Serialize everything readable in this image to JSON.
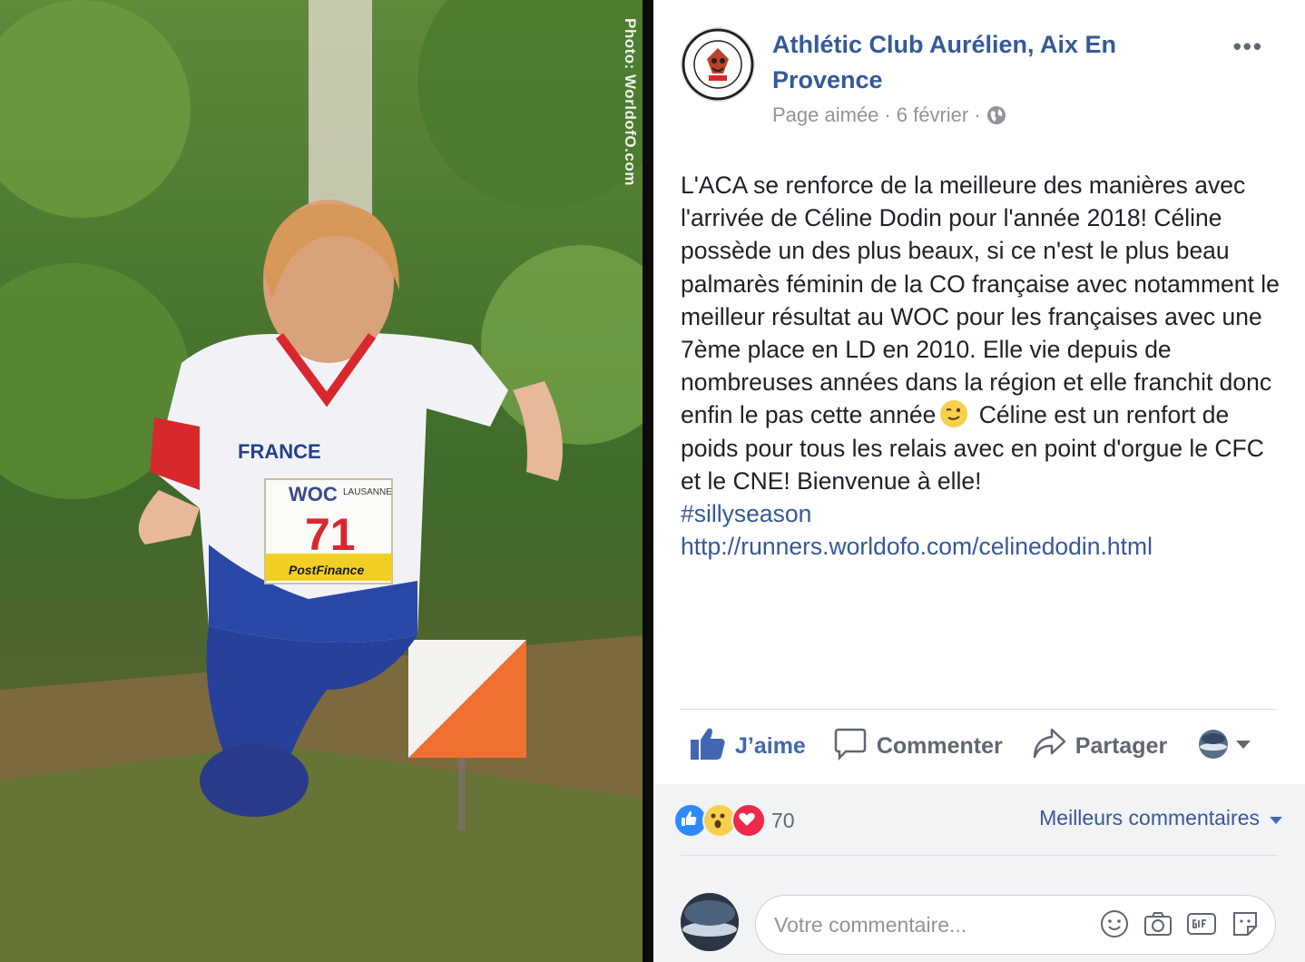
{
  "photo": {
    "credit": "Photo: WorldofO.com",
    "bib_number": "71",
    "bib_event": "WOC",
    "bib_event_detail": "LAUSANNE",
    "bib_sponsor": "PostFinance",
    "shirt_text": "FRANCE"
  },
  "post": {
    "page_name": "Athlétic Club Aurélien, Aix En Provence",
    "meta_status": "Page aimée",
    "meta_sep1": "·",
    "meta_date": "6 février",
    "meta_sep2": "·",
    "text_part1": "L'ACA se renforce de la meilleure des manières avec l'arrivée de Céline Dodin pour l'année 2018! Céline possède un des plus beaux, si ce n'est le plus beau palmarès féminin de la CO française avec notamment le meilleur résultat au WOC pour les françaises avec une 7ème place en LD en 2010. Elle vie depuis de nombreuses années dans la région et elle franchit donc enfin le pas cette année",
    "text_part2": "Céline est un renfort de poids pour tous les relais avec en point d'orgue le CFC et le CNE! Bienvenue à elle!",
    "hashtag": "#sillyseason",
    "link": "http://runners.worldofo.com/celinedodin.html"
  },
  "actions": {
    "like": "J’aime",
    "comment": "Commenter",
    "share": "Partager"
  },
  "reactions": {
    "count": "70",
    "sort_label": "Meilleurs commentaires"
  },
  "comment_box": {
    "placeholder": "Votre commentaire..."
  },
  "colors": {
    "link_blue": "#365899",
    "like_blue": "#4267b2",
    "muted": "#90949c",
    "text": "#1d2129"
  }
}
